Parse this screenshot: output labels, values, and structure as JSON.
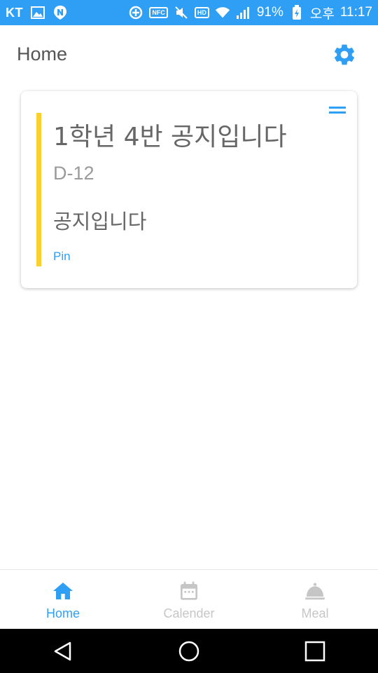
{
  "status_bar": {
    "carrier": "KT",
    "battery": "91%",
    "ampm": "오후",
    "time": "11:17",
    "nfc_label": "NFC",
    "hd_label": "HD",
    "icons": [
      "gallery-icon",
      "naver-icon",
      "add-circle-icon",
      "nfc-icon",
      "mute-icon",
      "hd-voice-icon",
      "wifi-icon",
      "signal-icon",
      "battery-icon"
    ]
  },
  "header": {
    "title": "Home",
    "settings_icon": "gear-icon"
  },
  "notice": {
    "title": "1학년 4반 공지입니다",
    "dday": "D-12",
    "body": "공지입니다",
    "pin_label": "Pin",
    "accent_color": "#fbcf2e"
  },
  "tabs": [
    {
      "label": "Home",
      "icon": "home-icon",
      "active": true
    },
    {
      "label": "Calender",
      "icon": "calendar-icon",
      "active": false
    },
    {
      "label": "Meal",
      "icon": "meal-icon",
      "active": false
    }
  ],
  "colors": {
    "accent": "#2f9ff5",
    "inactive": "#c6c6c6",
    "text": "#666666"
  }
}
